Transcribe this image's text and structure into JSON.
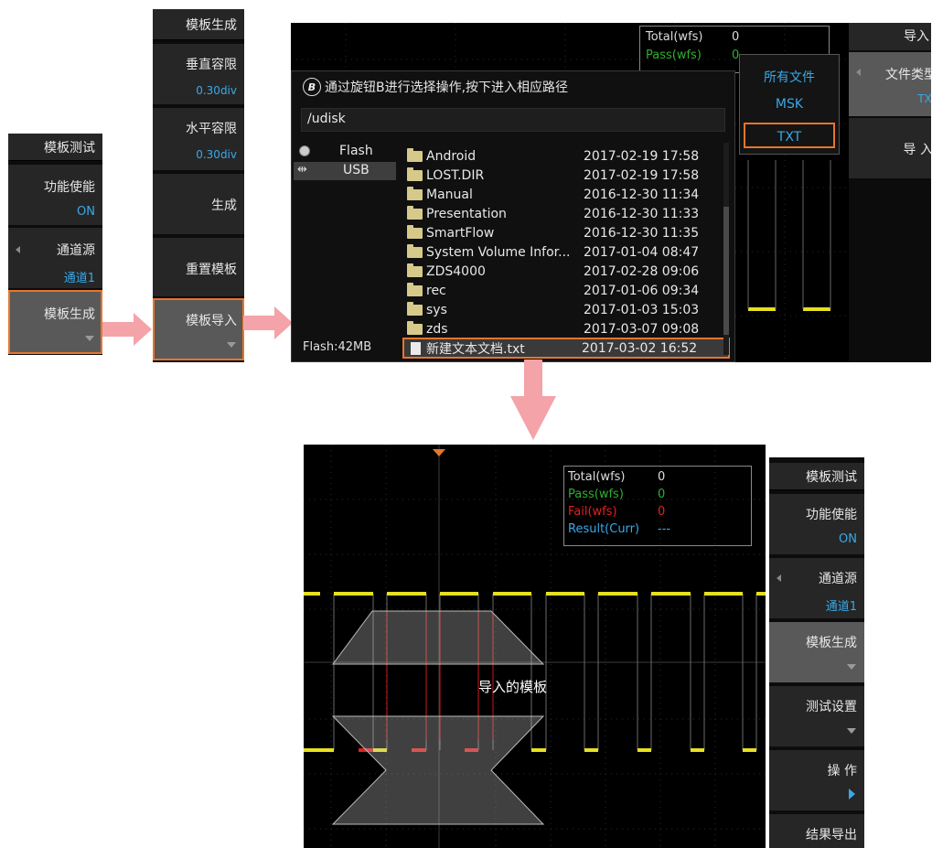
{
  "panel1": {
    "title": "模板测试",
    "items": [
      {
        "label": "功能使能",
        "value": "ON"
      },
      {
        "label": "通道源",
        "value": "通道1"
      },
      {
        "label": "模板生成"
      }
    ]
  },
  "panel2": {
    "title": "模板生成",
    "items": [
      {
        "label": "垂直容限",
        "value": "0.30div"
      },
      {
        "label": "水平容限",
        "value": "0.30div"
      },
      {
        "label": "生成"
      },
      {
        "label": "重置模板"
      },
      {
        "label": "模板导入"
      }
    ]
  },
  "file_browser": {
    "hint_glyph": "B",
    "hint": "通过旋钮B进行选择操作,按下进入相应路径",
    "path": "/udisk",
    "drives": [
      {
        "label": "Flash",
        "icon": "disk-icon"
      },
      {
        "label": "USB",
        "icon": "usb-icon"
      }
    ],
    "storage": "Flash:42MB",
    "files": [
      {
        "name": "Android",
        "date": "2017-02-19 17:58",
        "type": "folder"
      },
      {
        "name": "LOST.DIR",
        "date": "2017-02-19 17:58",
        "type": "folder"
      },
      {
        "name": "Manual",
        "date": "2016-12-30 11:34",
        "type": "folder"
      },
      {
        "name": "Presentation",
        "date": "2016-12-30 11:33",
        "type": "folder"
      },
      {
        "name": "SmartFlow",
        "date": "2016-12-30 11:35",
        "type": "folder"
      },
      {
        "name": "System Volume Infor...",
        "date": "2017-01-04 08:47",
        "type": "folder"
      },
      {
        "name": "ZDS4000",
        "date": "2017-02-28 09:06",
        "type": "folder"
      },
      {
        "name": "rec",
        "date": "2017-01-06 09:34",
        "type": "folder"
      },
      {
        "name": "sys",
        "date": "2017-01-03 15:03",
        "type": "folder"
      },
      {
        "name": "zds",
        "date": "2017-03-07 09:08",
        "type": "folder"
      },
      {
        "name": "新建文本文档.txt",
        "date": "2017-03-02 16:52",
        "type": "file"
      }
    ]
  },
  "file_type_menu": {
    "options": [
      "所有文件",
      "MSK",
      "TXT"
    ],
    "selected": "TXT"
  },
  "top_right_softkeys": {
    "head": "导入",
    "type_label": "文件类型",
    "type_value": "TXT",
    "import_label": "导 入"
  },
  "top_stats_partial": {
    "total_label": "Total(wfs)",
    "total_value": "0",
    "pass_label": "Pass(wfs)",
    "pass_value": "0"
  },
  "bottom_stats": {
    "total_label": "Total(wfs)",
    "total_value": "0",
    "pass_label": "Pass(wfs)",
    "pass_value": "0",
    "fail_label": "Fail(wfs)",
    "fail_value": "0",
    "result_label": "Result(Curr)",
    "result_value": "---"
  },
  "template_caption": "导入的模板",
  "panel3": {
    "title": "模板测试",
    "items": [
      {
        "label": "功能使能",
        "value": "ON"
      },
      {
        "label": "通道源",
        "value": "通道1"
      },
      {
        "label": "模板生成"
      },
      {
        "label": "测试设置"
      },
      {
        "label": "操 作"
      },
      {
        "label": "结果导出"
      }
    ]
  },
  "colors": {
    "accent_orange": "#e8752a",
    "arrow_pink": "#f4a3a8",
    "pass_green": "#2fae2f",
    "fail_red": "#e02020",
    "result_blue": "#3aa8e8",
    "trace_yellow": "#e6e020"
  }
}
